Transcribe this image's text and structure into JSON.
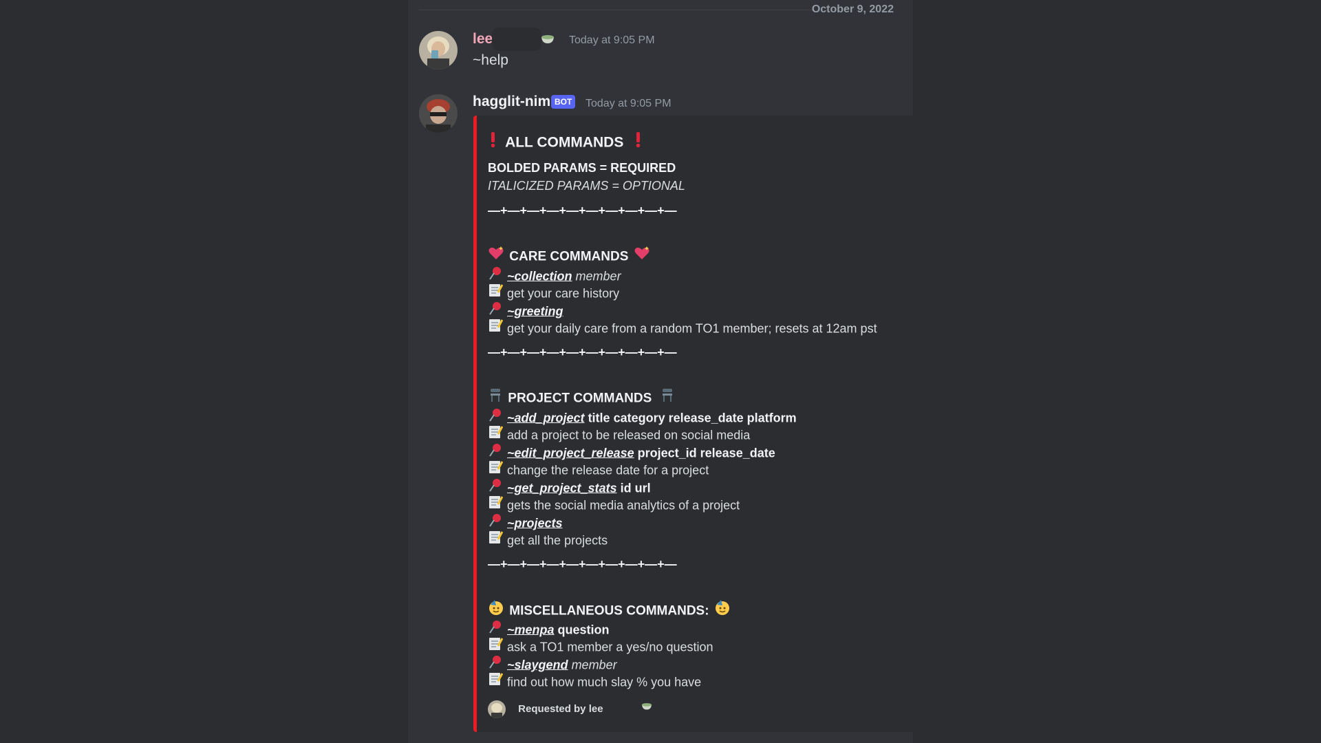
{
  "date_divider": "October 9, 2022",
  "message1": {
    "author": "lee",
    "timestamp": "Today at 9:05 PM",
    "text": "~help"
  },
  "message2": {
    "author": "hagglit-nim",
    "bot_tag": "BOT",
    "timestamp": "Today at 9:05 PM",
    "embed": {
      "accent_color": "#ed1c24",
      "title": "ALL COMMANDS",
      "legend_bold": "BOLDED PARAMS = REQUIRED",
      "legend_italic": "ITALICIZED PARAMS = OPTIONAL",
      "separator": "—+—+—+—+—+—+—+—+—+—",
      "care": {
        "heading": "CARE COMMANDS",
        "items": [
          {
            "cmd": "~collection",
            "params": "member",
            "params_style": "italic",
            "desc": "get your care history"
          },
          {
            "cmd": "~greeting",
            "params": "",
            "params_style": "none",
            "desc": "get your daily care from a random TO1 member; resets at 12am pst"
          }
        ]
      },
      "project": {
        "heading": "PROJECT COMMANDS",
        "items": [
          {
            "cmd": "~add_project",
            "params": "title category release_date platform",
            "params_style": "bold",
            "desc": "add a project to be released on social media"
          },
          {
            "cmd": "~edit_project_release",
            "params": "project_id release_date",
            "params_style": "bold",
            "desc": "change the release date for a project"
          },
          {
            "cmd": "~get_project_stats",
            "params": "id url",
            "params_style": "bold",
            "desc": "gets the social media analytics of a project"
          },
          {
            "cmd": "~projects",
            "params": "",
            "params_style": "none",
            "desc": "get all the projects"
          }
        ]
      },
      "misc": {
        "heading": "MISCELLANEOUS COMMANDS:",
        "items": [
          {
            "cmd": "~menpa",
            "params": "question",
            "params_style": "bold",
            "desc": "ask a TO1 member a yes/no question"
          },
          {
            "cmd": "~slaygend",
            "params": "member",
            "params_style": "italic",
            "desc": "find out how much slay % you have"
          }
        ]
      },
      "footer": "Requested by lee"
    }
  },
  "icons": {
    "exclamation": "red-exclamation-icon",
    "heart": "sparkling-heart-icon",
    "chair": "chair-icon",
    "party": "partying-face-icon",
    "pin": "pushpin-icon",
    "memo": "memo-icon",
    "bowl": "bowl-icon"
  }
}
